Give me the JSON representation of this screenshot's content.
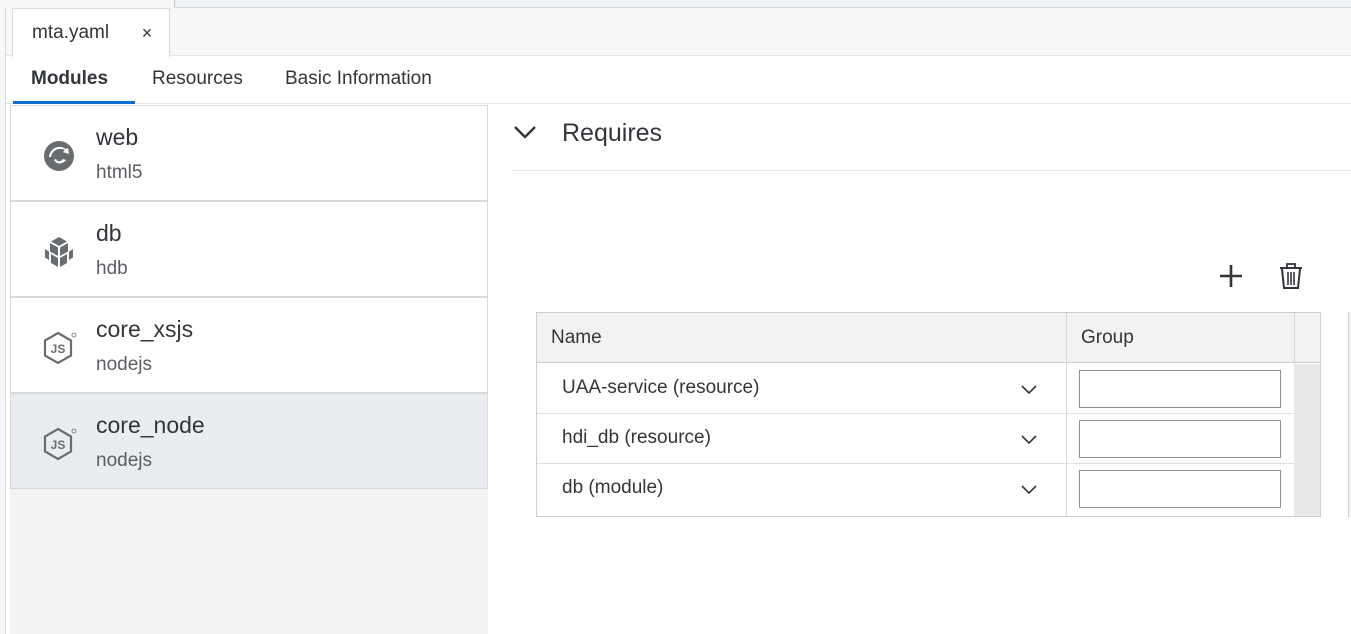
{
  "file_tab": {
    "name": "mta.yaml",
    "close": "×"
  },
  "tabs": [
    {
      "label": "Modules"
    },
    {
      "label": "Resources"
    },
    {
      "label": "Basic Information"
    }
  ],
  "modules": [
    {
      "name": "web",
      "type": "html5",
      "icon": "html5-module-icon"
    },
    {
      "name": "db",
      "type": "hdb",
      "icon": "hdb-module-icon"
    },
    {
      "name": "core_xsjs",
      "type": "nodejs",
      "icon": "nodejs-icon"
    },
    {
      "name": "core_node",
      "type": "nodejs",
      "icon": "nodejs-icon",
      "selected": true
    }
  ],
  "requires": {
    "title": "Requires",
    "columns": {
      "name": "Name",
      "group": "Group"
    },
    "rows": [
      {
        "name": "UAA-service (resource)",
        "group": ""
      },
      {
        "name": "hdi_db (resource)",
        "group": ""
      },
      {
        "name": "db (module)",
        "group": ""
      }
    ]
  },
  "colors": {
    "accent": "#0a6ed1",
    "selected_bg": "#e9edf2",
    "text": "#32363a"
  }
}
